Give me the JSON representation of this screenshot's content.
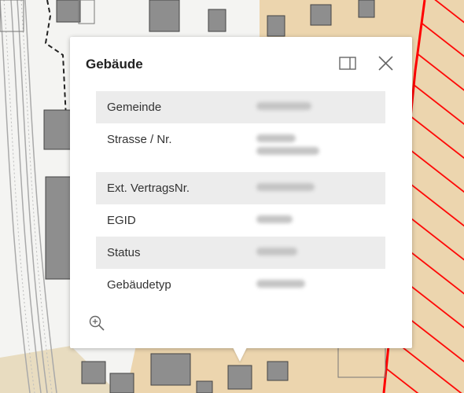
{
  "popup": {
    "title": "Gebäude",
    "dock_icon": "dock-panel-icon",
    "close_icon": "close-icon",
    "zoom_icon": "zoom-in-icon"
  },
  "attributes": [
    {
      "key": "Gemeinde"
    },
    {
      "key": "Strasse / Nr."
    },
    {
      "key": "Ext. VertragsNr."
    },
    {
      "key": "EGID"
    },
    {
      "key": "Status"
    },
    {
      "key": "Gebäudetyp"
    }
  ],
  "colors": {
    "hatch_red": "#ff0000",
    "zone_beige": "#ecd5ae",
    "building_gray": "#8e8e8e",
    "row_shade": "#ececec"
  }
}
